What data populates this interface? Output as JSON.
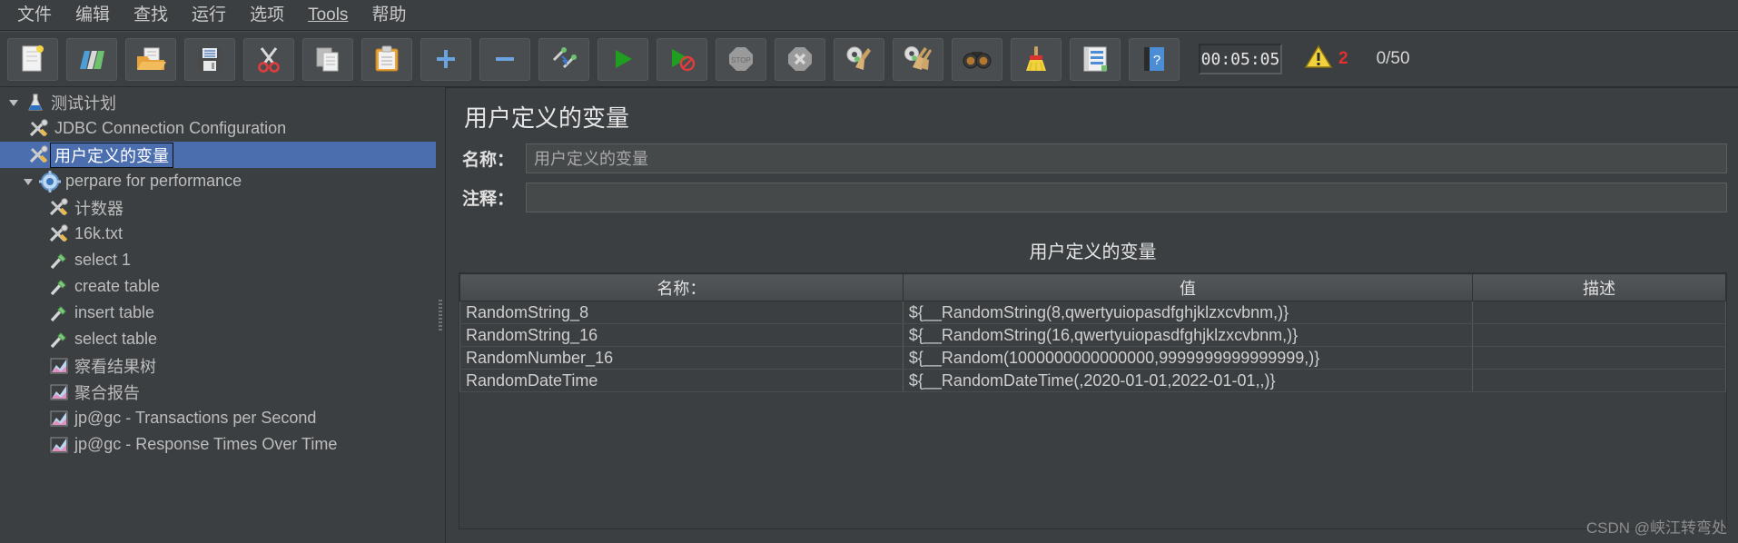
{
  "menubar": {
    "items": [
      {
        "label": "文件",
        "name": "menu-file"
      },
      {
        "label": "编辑",
        "name": "menu-edit"
      },
      {
        "label": "查找",
        "name": "menu-search"
      },
      {
        "label": "运行",
        "name": "menu-run"
      },
      {
        "label": "选项",
        "name": "menu-options"
      },
      {
        "label": "Tools",
        "name": "menu-tools"
      },
      {
        "label": "帮助",
        "name": "menu-help"
      }
    ]
  },
  "toolbar": {
    "buttons": [
      {
        "icon": "new-file-icon",
        "name": "new-button"
      },
      {
        "icon": "templates-icon",
        "name": "templates-button"
      },
      {
        "icon": "open-folder-icon",
        "name": "open-button"
      },
      {
        "icon": "save-icon",
        "name": "save-button"
      },
      {
        "icon": "scissors-icon",
        "name": "cut-button"
      },
      {
        "icon": "copy-icon",
        "name": "copy-button"
      },
      {
        "icon": "clipboard-icon",
        "name": "paste-button"
      },
      {
        "icon": "plus-icon",
        "name": "expand-button"
      },
      {
        "icon": "minus-icon",
        "name": "collapse-button"
      },
      {
        "icon": "toggle-icon",
        "name": "toggle-button"
      },
      {
        "icon": "play-icon",
        "name": "start-button"
      },
      {
        "icon": "play-no-timers-icon",
        "name": "start-no-pauses-button"
      },
      {
        "icon": "stop-icon",
        "name": "stop-button"
      },
      {
        "icon": "shutdown-icon",
        "name": "shutdown-button"
      },
      {
        "icon": "gear-broom-icon",
        "name": "clear-button"
      },
      {
        "icon": "gear-brooms-icon",
        "name": "clear-all-button"
      },
      {
        "icon": "binoculars-icon",
        "name": "search-button"
      },
      {
        "icon": "broom-icon",
        "name": "reset-search-button"
      },
      {
        "icon": "function-helper-icon",
        "name": "function-helper-button"
      },
      {
        "icon": "help-book-icon",
        "name": "help-button"
      }
    ],
    "timer": "00:05:05",
    "warning_count": "2",
    "threads": "0/50"
  },
  "tree": {
    "nodes": [
      {
        "label": "测试计划",
        "icon": "test-plan-icon",
        "indent": 0,
        "twisty": "expanded",
        "selected": false,
        "name": "tree-node-test-plan"
      },
      {
        "label": "JDBC Connection Configuration",
        "icon": "config-element-icon",
        "indent": 1,
        "twisty": "none",
        "selected": false,
        "name": "tree-node-jdbc-connection-configuration"
      },
      {
        "label": "用户定义的变量",
        "icon": "config-element-icon",
        "indent": 1,
        "twisty": "none",
        "selected": true,
        "name": "tree-node-user-defined-variables"
      },
      {
        "label": "perpare for performance",
        "icon": "thread-group-icon",
        "indent": 1,
        "twisty": "expanded",
        "selected": false,
        "name": "tree-node-perpare-for-performance"
      },
      {
        "label": "计数器",
        "icon": "config-element-icon",
        "indent": 2,
        "twisty": "none",
        "selected": false,
        "name": "tree-node-counter"
      },
      {
        "label": "16k.txt",
        "icon": "config-element-icon",
        "indent": 2,
        "twisty": "none",
        "selected": false,
        "name": "tree-node-16k-txt"
      },
      {
        "label": "select 1",
        "icon": "sampler-icon",
        "indent": 2,
        "twisty": "none",
        "selected": false,
        "name": "tree-node-select-1"
      },
      {
        "label": "create table",
        "icon": "sampler-icon",
        "indent": 2,
        "twisty": "none",
        "selected": false,
        "name": "tree-node-create-table"
      },
      {
        "label": "insert table",
        "icon": "sampler-icon",
        "indent": 2,
        "twisty": "none",
        "selected": false,
        "name": "tree-node-insert-table"
      },
      {
        "label": "select table",
        "icon": "sampler-icon",
        "indent": 2,
        "twisty": "none",
        "selected": false,
        "name": "tree-node-select-table"
      },
      {
        "label": "察看结果树",
        "icon": "listener-icon",
        "indent": 2,
        "twisty": "none",
        "selected": false,
        "name": "tree-node-view-results-tree"
      },
      {
        "label": "聚合报告",
        "icon": "listener-icon",
        "indent": 2,
        "twisty": "none",
        "selected": false,
        "name": "tree-node-aggregate-report"
      },
      {
        "label": "jp@gc - Transactions per Second",
        "icon": "listener-icon",
        "indent": 2,
        "twisty": "none",
        "selected": false,
        "name": "tree-node-transactions-per-second"
      },
      {
        "label": "jp@gc - Response Times Over Time",
        "icon": "listener-icon",
        "indent": 2,
        "twisty": "none",
        "selected": false,
        "name": "tree-node-response-times-over-time"
      }
    ]
  },
  "panel": {
    "title": "用户定义的变量",
    "name_label": "名称：",
    "name_value": "用户定义的变量",
    "comment_label": "注释：",
    "comment_value": "",
    "table_title": "用户定义的变量",
    "columns": [
      "名称：",
      "值",
      "描述"
    ],
    "rows": [
      [
        "RandomString_8",
        "${__RandomString(8,qwertyuiopasdfghjklzxcvbnm,)}",
        ""
      ],
      [
        "RandomString_16",
        "${__RandomString(16,qwertyuiopasdfghjklzxcvbnm,)}",
        ""
      ],
      [
        "RandomNumber_16",
        "${__Random(1000000000000000,9999999999999999,)}",
        ""
      ],
      [
        "RandomDateTime",
        "${__RandomDateTime(,2020-01-01,2022-01-01,,)}",
        ""
      ]
    ]
  },
  "watermark": "CSDN @峡江转弯处",
  "colors": {
    "selection": "#4b6eaf",
    "background": "#3c3f41",
    "warning": "#e03030"
  }
}
